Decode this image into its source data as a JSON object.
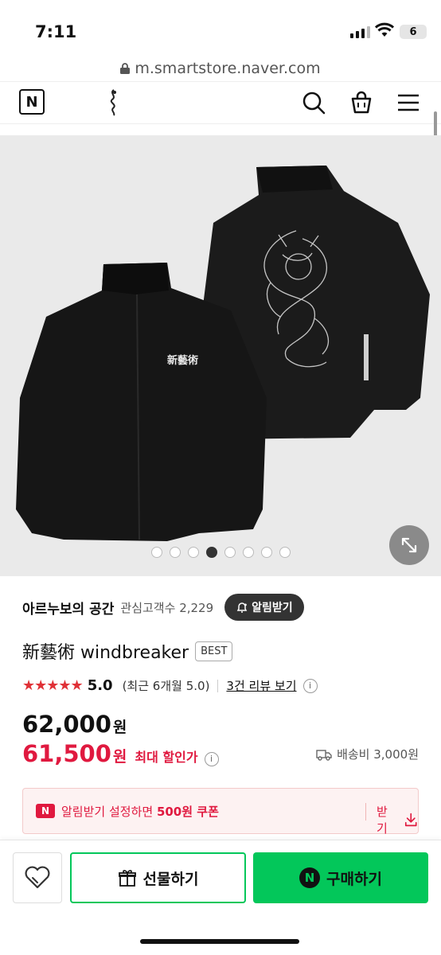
{
  "status_bar": {
    "time": "7:11",
    "battery": "6"
  },
  "url": {
    "host": "m.smartstore.naver.com"
  },
  "header": {
    "naver_logo": "N",
    "icons": [
      "search-icon",
      "shopping-bag-icon",
      "menu-icon"
    ]
  },
  "gallery": {
    "total_images": 8,
    "active_index": 4,
    "embroidery_text": "新藝術"
  },
  "store": {
    "name": "아르누보의 공간",
    "favorites_label": "관심고객수",
    "favorites_count": "2,229",
    "alarm_button": "알림받기"
  },
  "product": {
    "title": "新藝術 windbreaker",
    "badge": "BEST",
    "rating": "5.0",
    "rating_recent": "(최근 6개월 5.0)",
    "reviews_link": "3건 리뷰 보기",
    "original_price": "62,000",
    "original_unit": "원",
    "sale_price": "61,500",
    "sale_unit": "원",
    "sale_label": "최대 할인가",
    "shipping": "배송비 3,000원"
  },
  "coupon": {
    "badge": "N",
    "text_prefix": "알림받기 설정하면 ",
    "text_bold": "500원 쿠폰",
    "get_label": "받기"
  },
  "bottom_bar": {
    "gift_label": "선물하기",
    "buy_label": "구매하기",
    "buy_badge": "N"
  },
  "colors": {
    "naver_green": "#03c75a",
    "sale_red": "#e0193f",
    "star_red": "#e03137"
  }
}
